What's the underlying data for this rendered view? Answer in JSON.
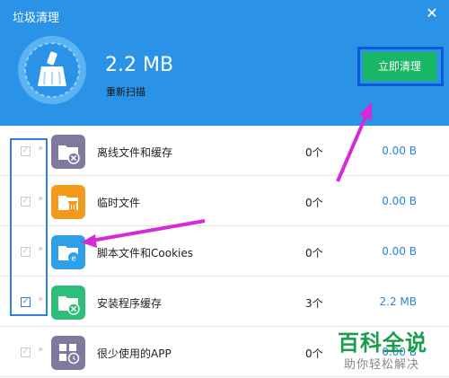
{
  "window": {
    "title": "垃圾清理",
    "close_icon": "close-icon"
  },
  "summary": {
    "size": "2.2 MB",
    "rescan_label": "重新扫描",
    "clean_button_label": "立即清理"
  },
  "items": [
    {
      "label": "离线文件和缓存",
      "count": "0个",
      "size": "0.00 B",
      "checked": false,
      "icon": "folder-x-icon",
      "icon_color": "#7d7a9e"
    },
    {
      "label": "临时文件",
      "count": "0个",
      "size": "0.00 B",
      "checked": false,
      "icon": "folder-trash-icon",
      "icon_color": "#f29a1c"
    },
    {
      "label": "脚本文件和Cookies",
      "count": "0个",
      "size": "0.00 B",
      "checked": false,
      "icon": "folder-browser-icon",
      "icon_color": "#2fa0e8"
    },
    {
      "label": "安装程序缓存",
      "count": "3个",
      "size": "2.2 MB",
      "checked": true,
      "icon": "folder-x-icon",
      "icon_color": "#2dbe7a"
    },
    {
      "label": "很少使用的APP",
      "count": "0个",
      "size": "0.00 B",
      "checked": false,
      "icon": "app-grid-icon",
      "icon_color": "#7d7a9e"
    }
  ],
  "watermark": {
    "title": "百科全说",
    "subtitle": "助你轻松解决"
  },
  "colors": {
    "header": "#2a93e8",
    "accent_button": "#19b765",
    "annotation": "#d62ad6",
    "size_link": "#2a86d8"
  }
}
